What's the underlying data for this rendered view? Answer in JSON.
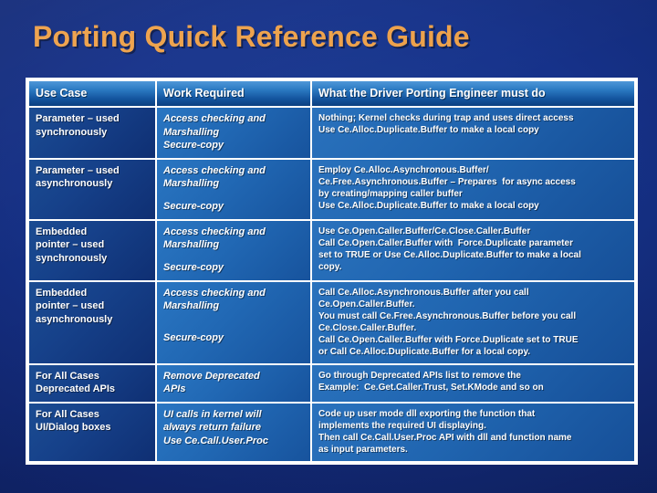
{
  "slide": {
    "title": "Porting Quick Reference Guide",
    "background_color": "#14308a",
    "title_color": "#eda14a"
  },
  "table": {
    "header_bg": "#2d7cc4",
    "col1_bg": "#16418a",
    "col2_bg": "#2168b4",
    "col3_bg": "#2065b0",
    "border_color": "#ffffff",
    "headers": [
      "Use Case",
      "Work Required",
      "What the Driver Porting Engineer must do"
    ],
    "rows": [
      {
        "use_case": [
          "Parameter – used",
          "synchronously"
        ],
        "work_required": [
          "Access checking and",
          "Marshalling",
          "Secure-copy"
        ],
        "engineer_must_do": [
          "Nothing; Kernel checks during trap and uses direct access",
          "Use Ce.Alloc.Duplicate.Buffer to make a local copy"
        ]
      },
      {
        "use_case": [
          "Parameter – used",
          "asynchronously"
        ],
        "work_required": [
          "Access checking and",
          "Marshalling",
          "",
          "Secure-copy"
        ],
        "engineer_must_do": [
          "Employ Ce.Alloc.Asynchronous.Buffer/",
          "Ce.Free.Asynchronous.Buffer – Prepares  for async access",
          "by creating/mapping caller buffer",
          "Use Ce.Alloc.Duplicate.Buffer to make a local copy"
        ]
      },
      {
        "use_case": [
          "Embedded",
          "pointer – used",
          "synchronously"
        ],
        "work_required": [
          "Access checking and",
          "Marshalling",
          "",
          "Secure-copy"
        ],
        "engineer_must_do": [
          "Use Ce.Open.Caller.Buffer/Ce.Close.Caller.Buffer",
          "Call Ce.Open.Caller.Buffer with  Force.Duplicate parameter",
          "set to TRUE or Use Ce.Alloc.Duplicate.Buffer to make a local",
          "copy."
        ]
      },
      {
        "use_case": [
          "Embedded",
          "pointer – used",
          "asynchronously"
        ],
        "work_required": [
          "Access checking and",
          "Marshalling",
          "",
          "",
          "Secure-copy"
        ],
        "engineer_must_do": [
          "Call Ce.Alloc.Asynchronous.Buffer after you call",
          "Ce.Open.Caller.Buffer.",
          "You must call Ce.Free.Asynchronous.Buffer before you call",
          "Ce.Close.Caller.Buffer.",
          "Call Ce.Open.Caller.Buffer with Force.Duplicate set to TRUE",
          "or Call Ce.Alloc.Duplicate.Buffer for a local copy."
        ]
      },
      {
        "use_case": [
          "For All Cases",
          "Deprecated APIs"
        ],
        "work_required": [
          "Remove Deprecated",
          "APIs"
        ],
        "engineer_must_do": [
          "Go through Deprecated APIs list to remove the",
          "Example:  Ce.Get.Caller.Trust, Set.KMode and so on"
        ]
      },
      {
        "use_case": [
          "For All Cases",
          "UI/Dialog boxes"
        ],
        "work_required": [
          "UI calls in kernel will",
          "always return failure",
          "Use Ce.Call.User.Proc"
        ],
        "engineer_must_do": [
          "Code up user mode dll exporting the function that",
          "implements the required UI displaying.",
          "Then call Ce.Call.User.Proc API with dll and function name",
          "as input parameters."
        ]
      }
    ]
  }
}
